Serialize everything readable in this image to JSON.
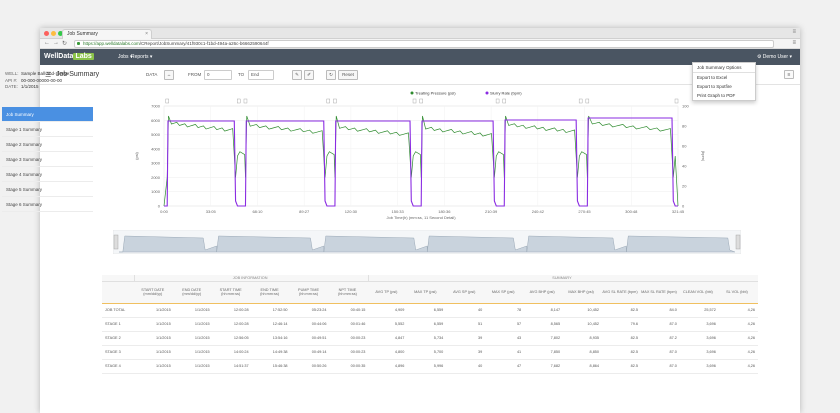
{
  "browser": {
    "tab_title": "Job Summary",
    "tab_close": "×",
    "url_host": "https://app.welldatalabs.com",
    "url_path": "/CReport/JobSummary/41f930c1-f1bd-494a-a26c-b6662590644f"
  },
  "app": {
    "logo_main": "WellData",
    "logo_lab": "Labs",
    "nav": [
      "Jobs ▾",
      "Reports ▾"
    ],
    "user": "⚙ Demo User ▾",
    "page_title": "Job Summary"
  },
  "dropdown": {
    "items": [
      "Job Summary Options",
      "Export to Excel",
      "Export to Spotfire",
      "Print Graph to PDF"
    ]
  },
  "well": {
    "well_label": "WELL:",
    "well_value": "Sample Ball-and-Sleeve",
    "api_label": "API #:",
    "api_value": "00-000-00000-00-00",
    "date_label": "DATE:",
    "date_value": "1/1/2015"
  },
  "sidebar": {
    "items": [
      "Job Summary",
      "Stage 1 Summary",
      "Stage 2 Summary",
      "Stage 3 Summary",
      "Stage 4 Summary",
      "Stage 5 Summary",
      "Stage 6 Summary"
    ]
  },
  "toolbar": {
    "data_label": "DATA",
    "data_btn": "↔",
    "from_label": "FROM",
    "from_value": "0",
    "to_label": "TO",
    "to_value": "End",
    "reset": "Reset"
  },
  "chart_data": {
    "type": "line",
    "legend": [
      "Treating Pressure (psi)",
      "Slurry Rate (bpm)"
    ],
    "colors": {
      "pressure": "#2e8b2e",
      "rate": "#8a2be2"
    },
    "xlabel": "Job Time(h) (mm:ss, 11 Second Detail)",
    "x_ticks": [
      "0:00",
      "33:05",
      "68:10",
      "89:27",
      "120:30",
      "150:33",
      "180:36",
      "210:39",
      "240:42",
      "270:45",
      "300:48",
      "321:45"
    ],
    "y_left_label": "(psi)",
    "y_left_ticks": [
      "0",
      "1000",
      "2000",
      "3000",
      "4000",
      "5000",
      "6000",
      "7000"
    ],
    "y_right_label": "(bpm)",
    "y_right_ticks": [
      "0",
      "20",
      "40",
      "60",
      "80",
      "100"
    ],
    "ylim_left": [
      0,
      7000
    ],
    "ylim_right": [
      0,
      100
    ],
    "stages": [
      {
        "start": 2,
        "end": 44,
        "rate": 85,
        "pressure": 5800
      },
      {
        "start": 51,
        "end": 100,
        "rate": 85,
        "pressure": 5650
      },
      {
        "start": 107,
        "end": 154,
        "rate": 85,
        "pressure": 5500
      },
      {
        "start": 161,
        "end": 206,
        "rate": 85,
        "pressure": 5450
      },
      {
        "start": 213,
        "end": 258,
        "rate": 86,
        "pressure": 5700
      },
      {
        "start": 265,
        "end": 318,
        "rate": 88,
        "pressure": 5800
      }
    ],
    "grid": true,
    "legend_position": "top-center"
  },
  "table": {
    "group1": "JOB INFORMATION",
    "group2": "SUMMARY",
    "headers": [
      "",
      "START DATE (mm/dd/yy)",
      "END DATE (mm/dd/yy)",
      "START TIME (hh:mm:ss)",
      "END TIME (hh:mm:ss)",
      "PUMP TIME (hh:mm:ss)",
      "NPT TIME (hh:mm:ss)",
      "AVG TP (psi)",
      "MAX TP (psi)",
      "AVG SP (psi)",
      "MAX SP (psi)",
      "AVG BHP (psi)",
      "MAX BHP (psi)",
      "AVG SL RATE (bpm)",
      "MAX SL RATE (bpm)",
      "CLEAN VOL (bbl)",
      "SL VOL (bbl)"
    ],
    "rows": [
      [
        "JOB TOTAL",
        "1/1/2015",
        "1/1/2015",
        "12:00:28",
        "17:52:50",
        "05:23:24",
        "00:40:15",
        "4,909",
        "6,559",
        "40",
        "78",
        "8,147",
        "10,452",
        "82.5",
        "84.0",
        "25,572",
        "4,26"
      ],
      [
        "STAGE 1",
        "1/1/2015",
        "1/1/2015",
        "12:00:28",
        "12:46:14",
        "00:44:06",
        "00:01:46",
        "5,552",
        "6,559",
        "51",
        "57",
        "8,565",
        "10,452",
        "79.6",
        "87.0",
        "3,696",
        "4,26"
      ],
      [
        "STAGE 2",
        "1/1/2015",
        "1/1/2015",
        "12:56:05",
        "13:54:16",
        "00:49:51",
        "00:00:23",
        "4,847",
        "5,734",
        "39",
        "43",
        "7,802",
        "8,935",
        "82.5",
        "87.2",
        "3,696",
        "4,26"
      ],
      [
        "STAGE 3",
        "1/1/2015",
        "1/1/2015",
        "14:00:24",
        "14:49:38",
        "00:49:14",
        "00:00:23",
        "4,800",
        "5,700",
        "39",
        "41",
        "7,850",
        "8,850",
        "82.5",
        "87.0",
        "3,696",
        "4,26"
      ],
      [
        "STAGE 4",
        "1/1/2015",
        "1/1/2015",
        "14:51:37",
        "15:46:38",
        "00:50:26",
        "00:00:35",
        "4,896",
        "5,996",
        "40",
        "47",
        "7,682",
        "8,864",
        "82.5",
        "87.0",
        "3,696",
        "4,26"
      ]
    ]
  }
}
